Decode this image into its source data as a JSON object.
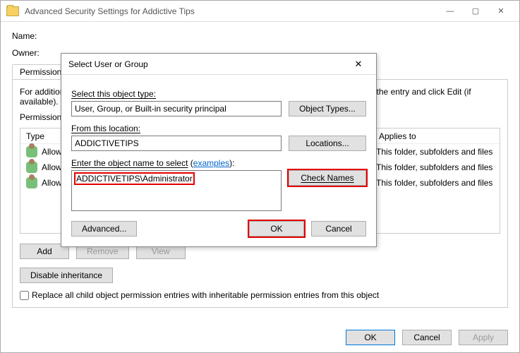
{
  "parent": {
    "title": "Advanced Security Settings for Addictive Tips",
    "name_label": "Name:",
    "owner_label": "Owner:",
    "tab_permissions": "Permissions",
    "instructions": "For additional information, double-click a permission entry. To modify a permission entry, select the entry and click Edit (if available).",
    "perm_section_label": "Permission entries:",
    "col_type": "Type",
    "col_applies": "Applies to",
    "rows": [
      {
        "type": "Allow",
        "applies": "This folder, subfolders and files"
      },
      {
        "type": "Allow",
        "applies": "This folder, subfolders and files"
      },
      {
        "type": "Allow",
        "applies": "This folder, subfolders and files"
      }
    ],
    "add_btn": "Add",
    "remove_btn": "Remove",
    "view_btn": "View",
    "disable_inheritance_btn": "Disable inheritance",
    "replace_checkbox": "Replace all child object permission entries with inheritable permission entries from this object",
    "ok_btn": "OK",
    "cancel_btn": "Cancel",
    "apply_btn": "Apply"
  },
  "modal": {
    "title": "Select User or Group",
    "obj_type_label": "Select this object type:",
    "obj_type_value": "User, Group, or Built-in security principal",
    "obj_types_btn": "Object Types...",
    "location_label": "From this location:",
    "location_value": "ADDICTIVETIPS",
    "locations_btn": "Locations...",
    "object_name_label": "Enter the object name to select",
    "examples_word": "examples",
    "object_name_value": "ADDICTIVETIPS\\Administrator",
    "check_names_btn": "Check Names",
    "advanced_btn": "Advanced...",
    "ok_btn": "OK",
    "cancel_btn": "Cancel"
  }
}
